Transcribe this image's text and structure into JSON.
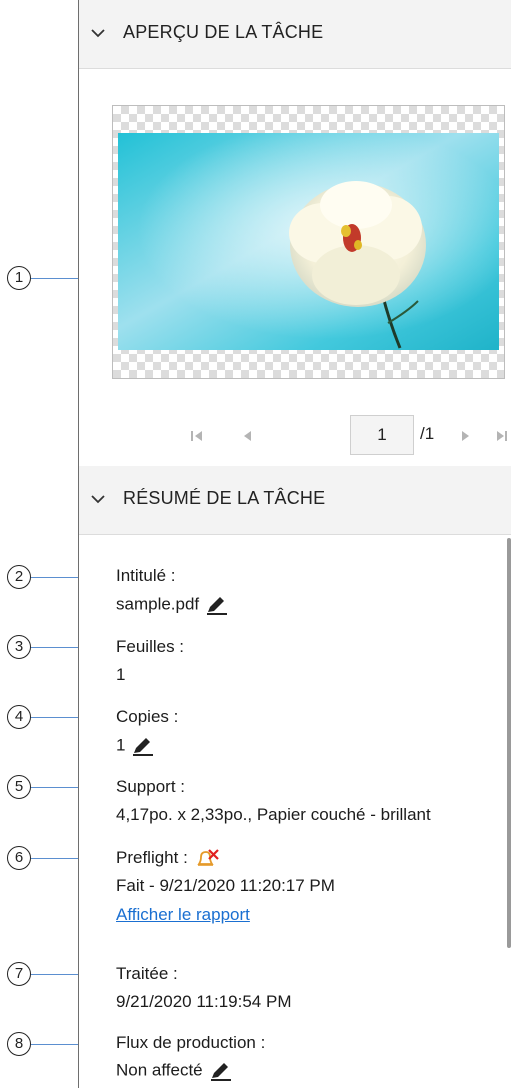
{
  "preview": {
    "header_title": "APERÇU DE LA TÂCHE",
    "page_current": "1",
    "page_total": "/1"
  },
  "summary": {
    "header_title": "RÉSUMÉ DE LA TÂCHE",
    "title_label": "Intitulé :",
    "title_value": "sample.pdf",
    "sheets_label": "Feuilles :",
    "sheets_value": "1",
    "copies_label": "Copies :",
    "copies_value": "1",
    "media_label": "Support :",
    "media_value": "4,17po. x 2,33po., Papier couché - brillant",
    "preflight_label": "Preflight :",
    "preflight_value": "Fait - 9/21/2020 11:20:17 PM",
    "preflight_link": "Afficher le rapport",
    "processed_label": "Traitée :",
    "processed_value": "9/21/2020 11:19:54 PM",
    "workflow_label": "Flux de production :",
    "workflow_value": "Non affecté"
  },
  "callouts": [
    "1",
    "2",
    "3",
    "4",
    "5",
    "6",
    "7",
    "8"
  ],
  "colors": {
    "link": "#1a6fd1",
    "leader": "#5b8fd0",
    "warning_bell": "#e59a2a",
    "error_x": "#e02020"
  },
  "icons": {
    "collapse": "chevron-down-icon",
    "edit": "pencil-icon",
    "preflight_status": "bell-error-icon",
    "pager": [
      "first-page-icon",
      "prev-page-icon",
      "next-page-icon",
      "last-page-icon"
    ]
  }
}
